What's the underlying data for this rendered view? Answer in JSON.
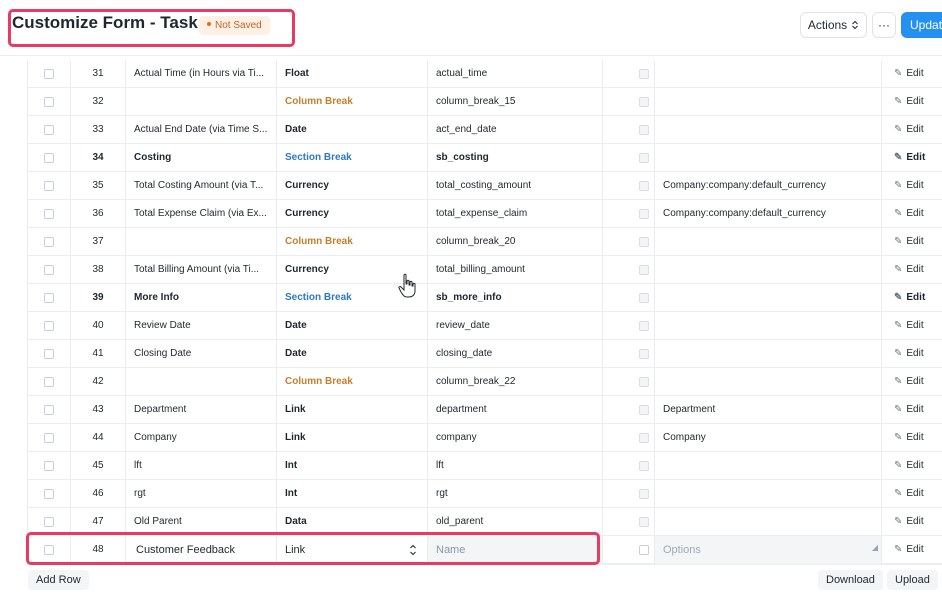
{
  "header": {
    "title": "Customize Form - Task",
    "status_badge": "Not Saved",
    "actions_label": "Actions",
    "actions_icon": "chevron-updown-icon",
    "more_label": "···",
    "update_label": "Update",
    "accent_color": "#2490ef",
    "highlight_color": "#e83a63"
  },
  "grid": {
    "edit_label": "Edit",
    "rows": [
      {
        "idx": "31",
        "label": "Actual Time (in Hours via Ti...",
        "type": "Float",
        "name": "actual_time",
        "options": ""
      },
      {
        "idx": "32",
        "label": "",
        "type": "Column Break",
        "name": "column_break_15",
        "options": ""
      },
      {
        "idx": "33",
        "label": "Actual End Date (via Time S...",
        "type": "Date",
        "name": "act_end_date",
        "options": ""
      },
      {
        "idx": "34",
        "label": "Costing",
        "type": "Section Break",
        "name": "sb_costing",
        "options": ""
      },
      {
        "idx": "35",
        "label": "Total Costing Amount (via T...",
        "type": "Currency",
        "name": "total_costing_amount",
        "options": "Company:company:default_currency"
      },
      {
        "idx": "36",
        "label": "Total Expense Claim (via Ex...",
        "type": "Currency",
        "name": "total_expense_claim",
        "options": "Company:company:default_currency"
      },
      {
        "idx": "37",
        "label": "",
        "type": "Column Break",
        "name": "column_break_20",
        "options": ""
      },
      {
        "idx": "38",
        "label": "Total Billing Amount (via Ti...",
        "type": "Currency",
        "name": "total_billing_amount",
        "options": ""
      },
      {
        "idx": "39",
        "label": "More Info",
        "type": "Section Break",
        "name": "sb_more_info",
        "options": ""
      },
      {
        "idx": "40",
        "label": "Review Date",
        "type": "Date",
        "name": "review_date",
        "options": ""
      },
      {
        "idx": "41",
        "label": "Closing Date",
        "type": "Date",
        "name": "closing_date",
        "options": ""
      },
      {
        "idx": "42",
        "label": "",
        "type": "Column Break",
        "name": "column_break_22",
        "options": ""
      },
      {
        "idx": "43",
        "label": "Department",
        "type": "Link",
        "name": "department",
        "options": "Department"
      },
      {
        "idx": "44",
        "label": "Company",
        "type": "Link",
        "name": "company",
        "options": "Company"
      },
      {
        "idx": "45",
        "label": "lft",
        "type": "Int",
        "name": "lft",
        "options": ""
      },
      {
        "idx": "46",
        "label": "rgt",
        "type": "Int",
        "name": "rgt",
        "options": ""
      },
      {
        "idx": "47",
        "label": "Old Parent",
        "type": "Data",
        "name": "old_parent",
        "options": ""
      }
    ],
    "edit_row": {
      "idx": "48",
      "label_value": "Customer Feedback",
      "type_value": "Link",
      "name_placeholder": "Name",
      "options_placeholder": "Options"
    }
  },
  "footer": {
    "add_row_label": "Add Row",
    "download_label": "Download",
    "upload_label": "Upload"
  }
}
